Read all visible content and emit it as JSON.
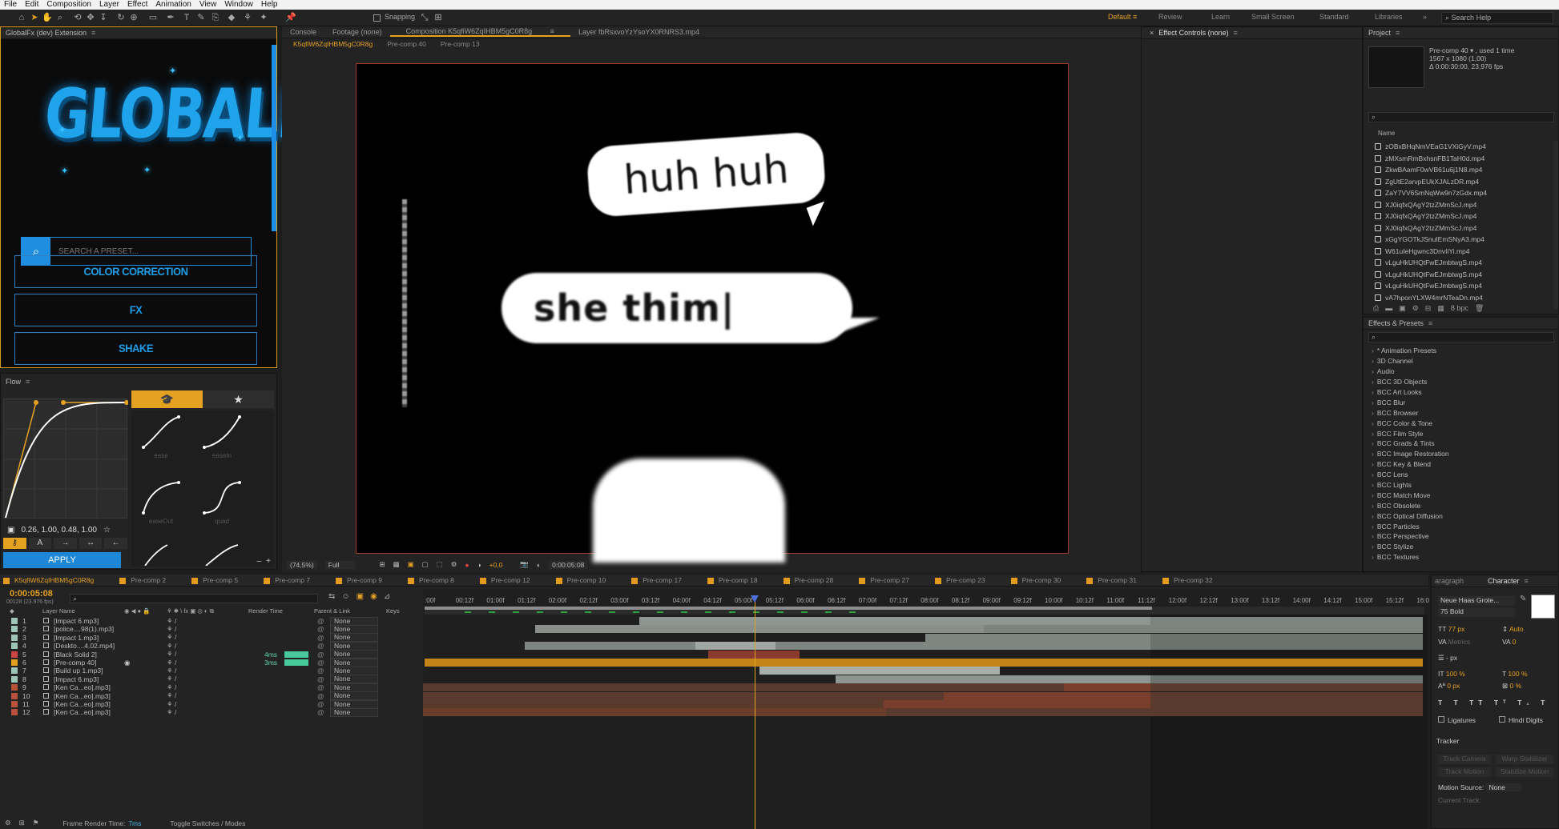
{
  "menubar": [
    "File",
    "Edit",
    "Composition",
    "Layer",
    "Effect",
    "Animation",
    "View",
    "Window",
    "Help"
  ],
  "toolbar": {
    "snapping": "Snapping",
    "workspaces": [
      "Default",
      "Review",
      "Learn",
      "Small Screen",
      "Standard",
      "Libraries"
    ],
    "search": "Search Help"
  },
  "globalfx": {
    "title": "GlobalFx (dev) Extension",
    "logo": "GLOBALFX",
    "reg": "®",
    "search_placeholder": "SEARCH A PRESET...",
    "buttons": [
      "COLOR CORRECTION",
      "FX",
      "SHAKE"
    ]
  },
  "flow": {
    "title": "Flow",
    "value": "0.26, 1.00, 0.48, 1.00",
    "apply": "APPLY",
    "presets": [
      "ease",
      "easeIn",
      "easeOut",
      "quad"
    ]
  },
  "composition": {
    "tabs": [
      "Console",
      "Footage (none)",
      "Composition K5qfiW6ZqIHBM5gC0R8g",
      "Layer fbRsxvoYzYsoYX0RNRS3.mp4"
    ],
    "crumbs": [
      "K5qfiW6ZqIHBM5gC0R8g",
      "Pre-comp 40",
      "Pre-comp 13"
    ],
    "bubbles": {
      "top": "huh huh",
      "mid": "she thim|"
    },
    "bar": {
      "zoom": "(74,5%)",
      "quality": "Full",
      "exposure": "+0,0",
      "time": "0:00:05:08"
    }
  },
  "effect_controls": {
    "title": "Effect Controls (none)"
  },
  "project": {
    "title": "Project",
    "info": [
      "Pre-comp 40 ▾ , used 1 time",
      "1567 x 1080 (1,00)",
      "Δ 0:00:30:00, 23,976 fps"
    ],
    "column": "Name",
    "items": [
      "zOBxBHqNmVEaG1VXiGyV.mp4",
      "zMXsmRmBxhsnFB1TaH0d.mp4",
      "ZkwBAamF0wVB61u6j1N8.mp4",
      "ZgUtE2arvpEUkXJALzDR.mp4",
      "ZaY7VV6SmNqWw9n7zGdx.mp4",
      "XJ0iqfxQAgY2tzZMmScJ.mp4",
      "XJ0iqfxQAgY2tzZMmScJ.mp4",
      "XJ0iqfxQAgY2tzZMmScJ.mp4",
      "xGgYGOTkJSnuIEmSNyA3.mp4",
      "W61uIeHgwnc3DnvIiYi.mp4",
      "vLguHkUHQtFwEJmbtwgS.mp4",
      "vLguHkUHQtFwEJmbtwgS.mp4",
      "vLguHkUHQtFwEJmbtwgS.mp4",
      "vA7hponYLXW4mrNTeaDn.mp4"
    ],
    "bpc": "8 bpc"
  },
  "effects": {
    "title": "Effects & Presets",
    "items": [
      "* Animation Presets",
      "3D Channel",
      "Audio",
      "BCC 3D Objects",
      "BCC Art Looks",
      "BCC Blur",
      "BCC Browser",
      "BCC Color & Tone",
      "BCC Film Style",
      "BCC Grads & Tints",
      "BCC Image Restoration",
      "BCC Key & Blend",
      "BCC Lens",
      "BCC Lights",
      "BCC Match Move",
      "BCC Obsolete",
      "BCC Optical Diffusion",
      "BCC Particles",
      "BCC Perspective",
      "BCC Stylize",
      "BCC Textures"
    ]
  },
  "timeline": {
    "tabs": [
      "K5qfiW6ZqIHBM5gC0R8g",
      "Pre-comp 2",
      "Pre-comp 5",
      "Pre-comp 7",
      "Pre-comp 9",
      "Pre-comp 8",
      "Pre-comp 12",
      "Pre-comp 10",
      "Pre-comp 17",
      "Pre-comp 18",
      "Pre-comp 28",
      "Pre-comp 27",
      "Pre-comp 23",
      "Pre-comp 30",
      "Pre-comp 31",
      "Pre-comp 32"
    ],
    "timecode": "0:00:05:08",
    "frame": "00128 (23.976 fps)",
    "headers": [
      "Layer Name",
      "Render Time",
      "Parent & Link",
      "Keys"
    ],
    "ruler": [
      ":00f",
      "00:12f",
      "01:00f",
      "01:12f",
      "02:00f",
      "02:12f",
      "03:00f",
      "03:12f",
      "04:00f",
      "04:12f",
      "05:00f",
      "05:12f",
      "06:00f",
      "06:12f",
      "07:00f",
      "07:12f",
      "08:00f",
      "08:12f",
      "09:00f",
      "09:12f",
      "10:00f",
      "10:12f",
      "11:00f",
      "11:12f",
      "12:00f",
      "12:12f",
      "13:00f",
      "13:12f",
      "14:00f",
      "14:12f",
      "15:00f",
      "15:12f",
      "16:0"
    ],
    "layers": [
      {
        "n": "1",
        "name": "[Impact 6.mp3]",
        "color": "#9ec3b7",
        "rt": "",
        "par": "None"
      },
      {
        "n": "2",
        "name": "[police....98(1).mp3]",
        "color": "#9ec3b7",
        "rt": "",
        "par": "None"
      },
      {
        "n": "3",
        "name": "[Impact 1.mp3]",
        "color": "#9ec3b7",
        "rt": "",
        "par": "None"
      },
      {
        "n": "4",
        "name": "[Deskto....4.02.mp4]",
        "color": "#9ec3b7",
        "rt": "",
        "par": "None"
      },
      {
        "n": "5",
        "name": "[Black Solid 2]",
        "color": "#c44",
        "rt": "4ms",
        "par": "None"
      },
      {
        "n": "6",
        "name": "[Pre-comp 40]",
        "color": "#e3a020",
        "rt": "3ms",
        "par": "None"
      },
      {
        "n": "7",
        "name": "[Build up 1.mp3]",
        "color": "#9ec3b7",
        "rt": "",
        "par": "None"
      },
      {
        "n": "8",
        "name": "[Impact 6.mp3]",
        "color": "#9ec3b7",
        "rt": "",
        "par": "None"
      },
      {
        "n": "9",
        "name": "[Ken Ca...eo].mp3]",
        "color": "#b5533a",
        "rt": "",
        "par": "None"
      },
      {
        "n": "10",
        "name": "[Ken Ca...eo].mp3]",
        "color": "#b5533a",
        "rt": "",
        "par": "None"
      },
      {
        "n": "11",
        "name": "[Ken Ca...eo].mp3]",
        "color": "#b5533a",
        "rt": "",
        "par": "None"
      },
      {
        "n": "12",
        "name": "[Ken Ca...eo].mp3]",
        "color": "#b5533a",
        "rt": "",
        "par": "None"
      }
    ],
    "status": {
      "frame_label": "Frame Render Time:",
      "frame_value": "7ms",
      "toggle": "Toggle Switches / Modes"
    }
  },
  "character": {
    "tabs": [
      "aragraph",
      "Character"
    ],
    "font": "Neue Haas Grote...",
    "style": "75 Bold",
    "size": "77 px",
    "leading": "Auto",
    "kerning": "Metrics",
    "tracking": "0",
    "stroke": "- px",
    "vscale": "100 %",
    "hscale": "100 %",
    "baseline": "0 px",
    "tsume": "0 %",
    "ligatures": "Ligatures",
    "hindi": "Hindi Digits",
    "tracker": "Tracker",
    "tracker_btns": [
      "Track Camera",
      "Warp Stabilizer",
      "Track Motion",
      "Stabilize Motion"
    ],
    "motion_source_label": "Motion Source:",
    "motion_source": "None",
    "current_track": "Current Track:"
  }
}
